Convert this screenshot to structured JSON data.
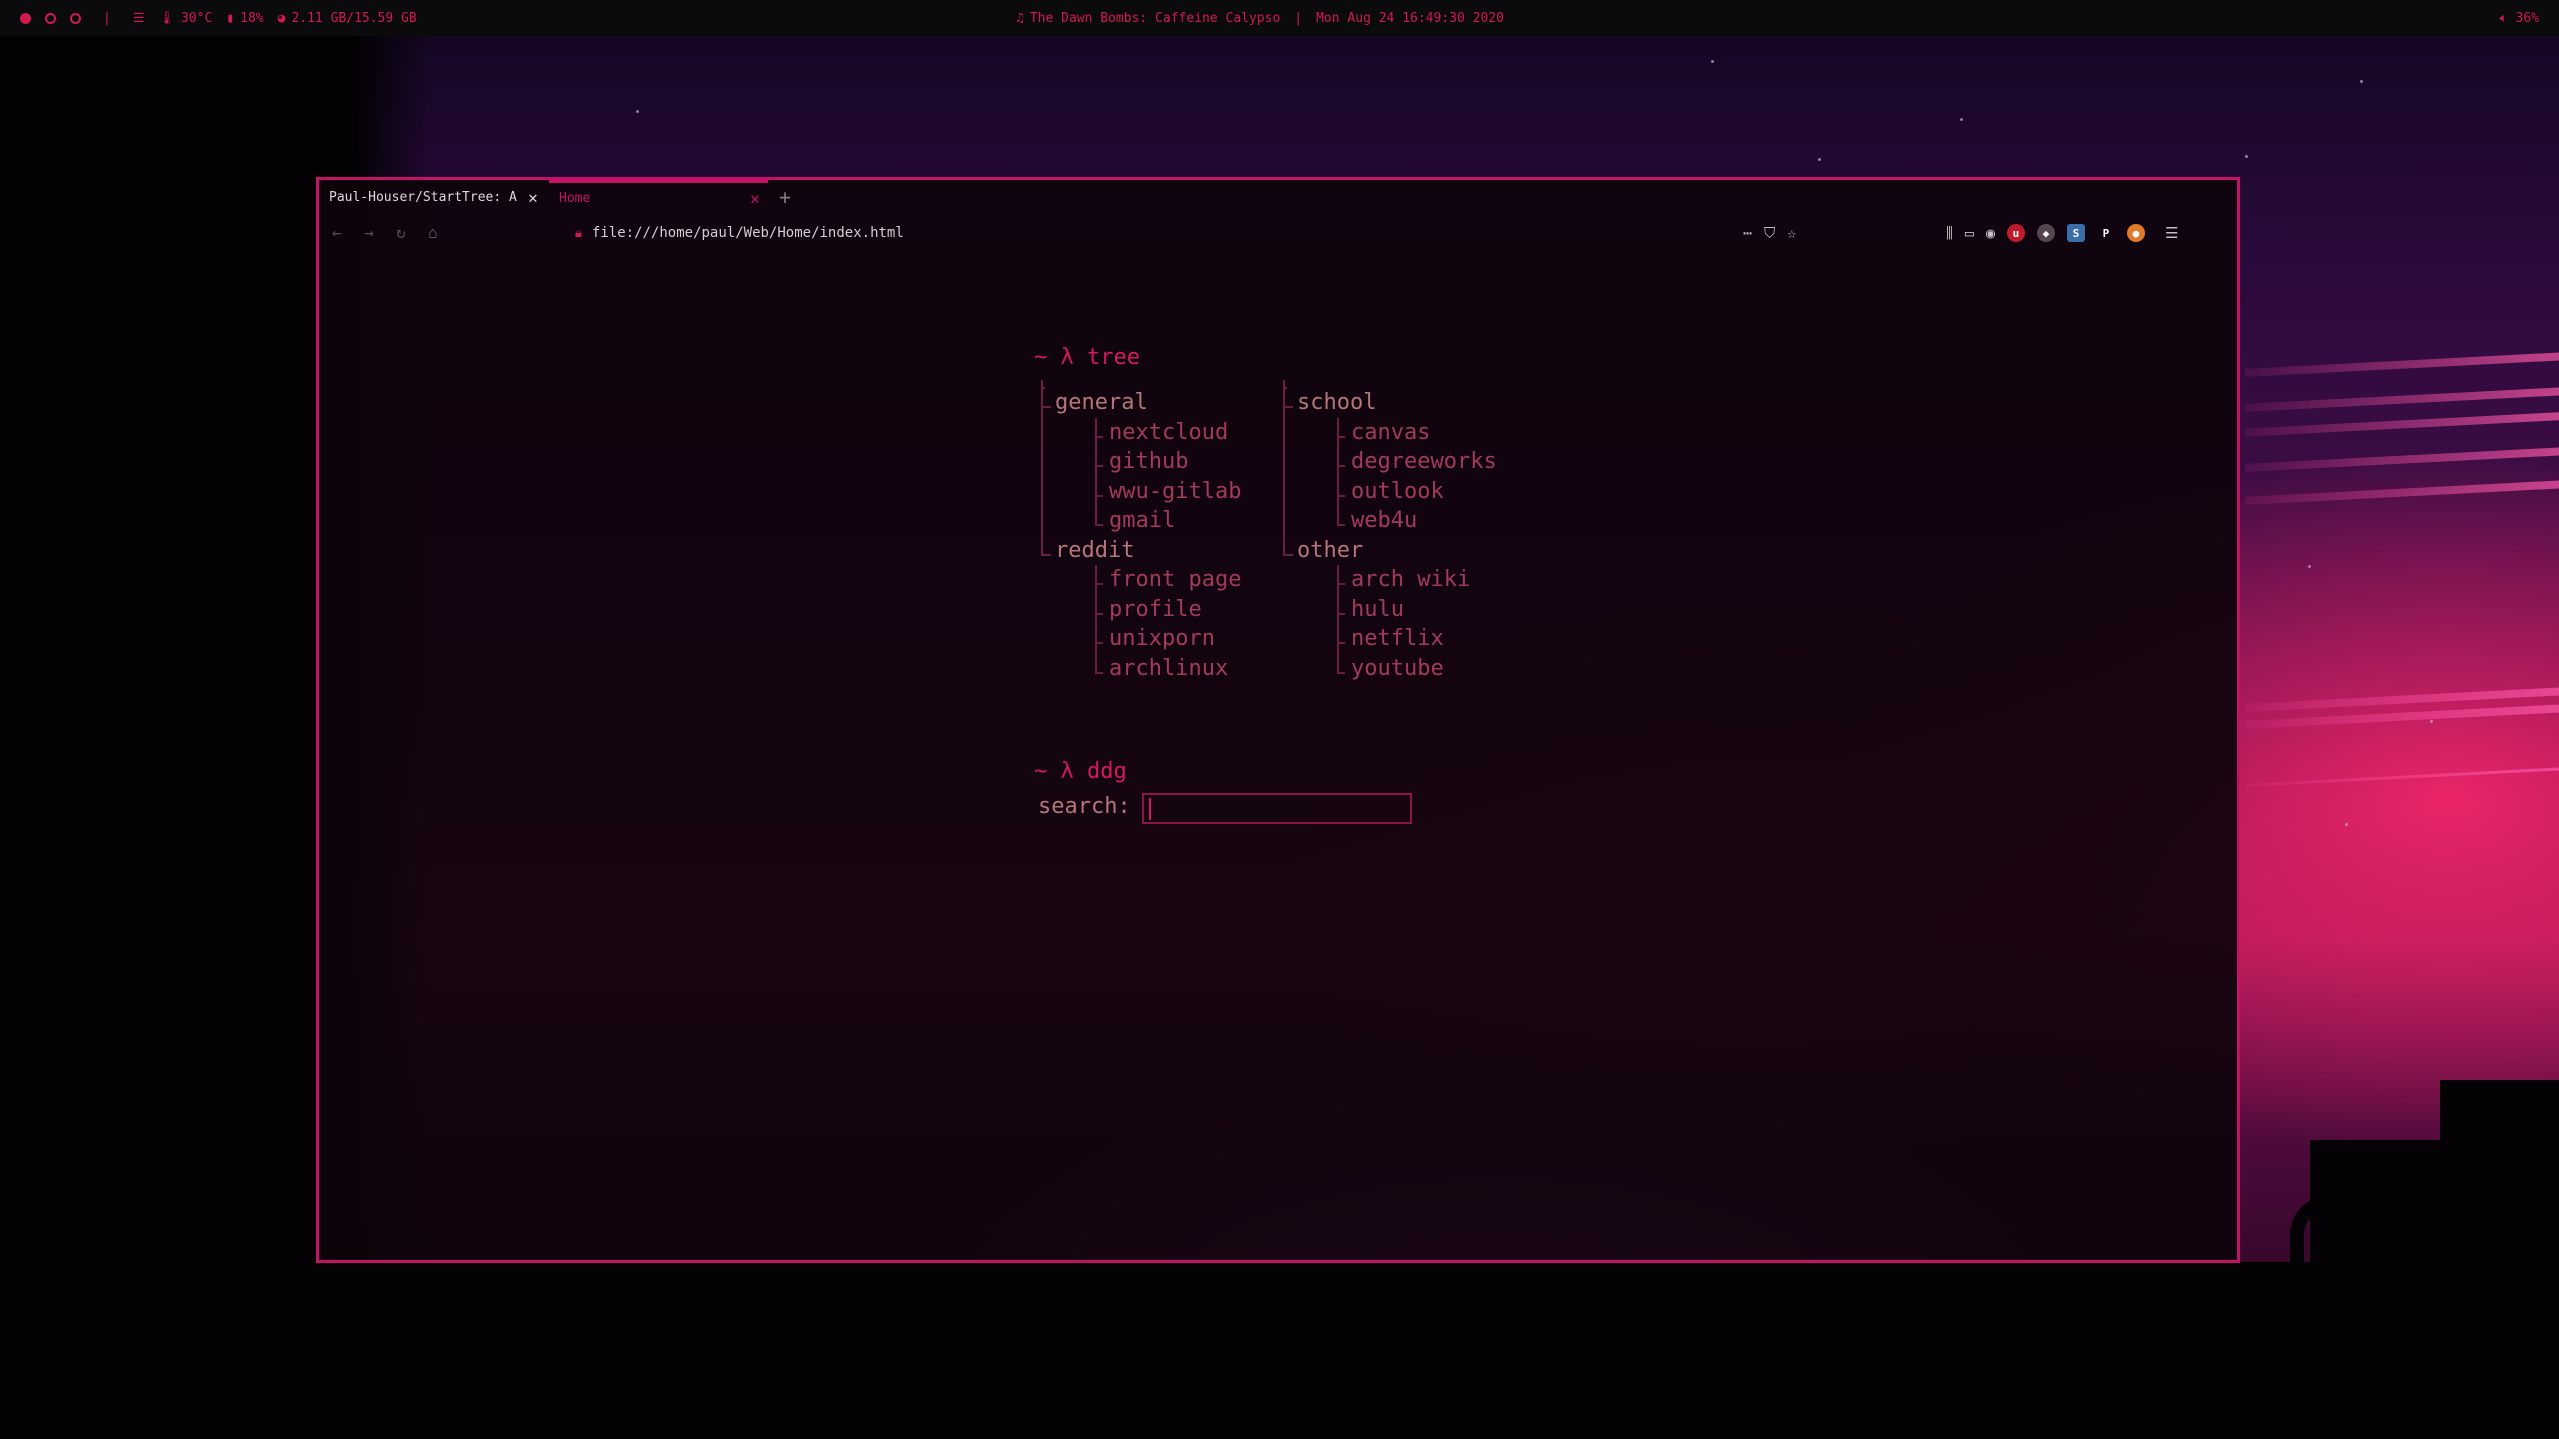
{
  "topbar": {
    "workspaces": [
      "active",
      "empty",
      "empty"
    ],
    "temperature": "30°C",
    "battery": "18%",
    "memory": "2.11 GB/15.59 GB",
    "now_playing": "The Dawn Bombs: Caffeine Calypso",
    "separator": "|",
    "datetime": "Mon Aug 24 16:49:30 2020",
    "volume": "36%"
  },
  "browser": {
    "tabs": [
      {
        "title": "Paul-Houser/StartTree: A",
        "active": false
      },
      {
        "title": "Home",
        "active": true
      }
    ],
    "url": "file:///home/paul/Web/Home/index.html"
  },
  "startpage": {
    "tree_prompt": "~ λ tree",
    "tree_root": ".",
    "columns": [
      {
        "groups": [
          {
            "name": "general",
            "items": [
              "nextcloud",
              "github",
              "wwu-gitlab",
              "gmail"
            ]
          },
          {
            "name": "reddit",
            "items": [
              "front page",
              "profile",
              "unixporn",
              "archlinux"
            ]
          }
        ]
      },
      {
        "groups": [
          {
            "name": "school",
            "items": [
              "canvas",
              "degreeworks",
              "outlook",
              "web4u"
            ]
          },
          {
            "name": "other",
            "items": [
              "arch wiki",
              "hulu",
              "netflix",
              "youtube"
            ]
          }
        ]
      }
    ],
    "search_prompt": "~ λ ddg",
    "search_label": "search:",
    "search_value": ""
  },
  "colors": {
    "accent": "#d4195f",
    "window_border": "#c41266",
    "topbar_bg": "#0b0a0c"
  }
}
